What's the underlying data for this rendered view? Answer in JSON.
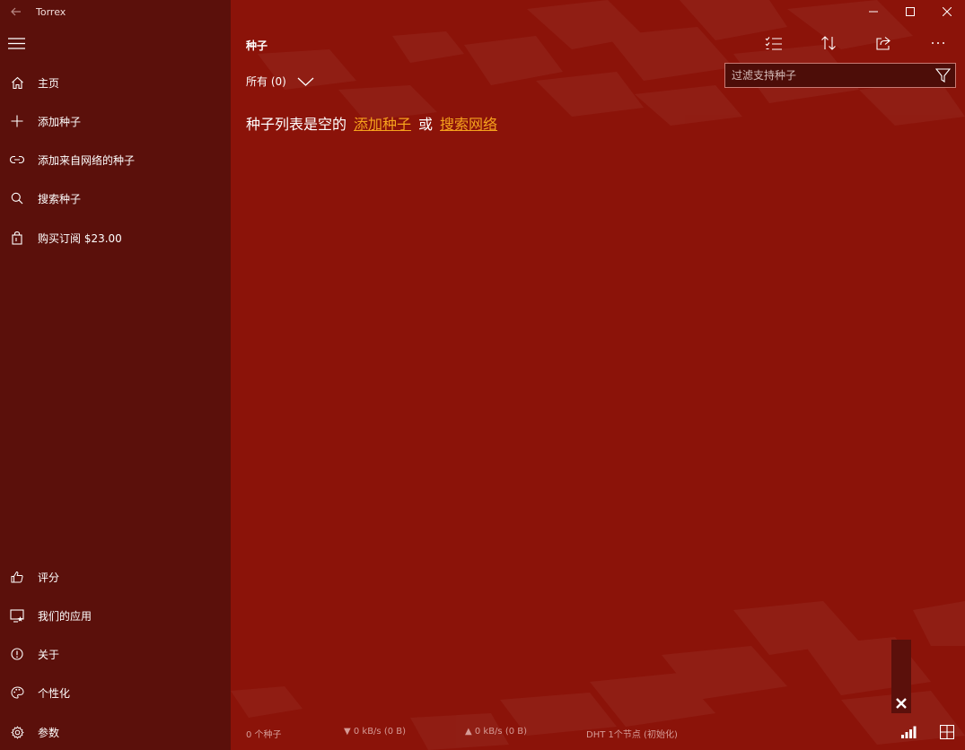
{
  "window": {
    "title": "Torrex",
    "back_icon": "arrow-left-icon"
  },
  "sidebar": {
    "top_items": [
      {
        "icon": "home-icon",
        "label": "主页"
      },
      {
        "icon": "plus-icon",
        "label": "添加种子"
      },
      {
        "icon": "link-icon",
        "label": "添加来自网络的种子"
      },
      {
        "icon": "search-icon",
        "label": "搜索种子"
      },
      {
        "icon": "shopping-bag-icon",
        "label": "购买订阅 $23.00"
      }
    ],
    "bottom_items": [
      {
        "icon": "thumbs-up-icon",
        "label": "评分"
      },
      {
        "icon": "apps-icon",
        "label": "我们的应用"
      },
      {
        "icon": "info-icon",
        "label": "关于"
      },
      {
        "icon": "palette-icon",
        "label": "个性化"
      },
      {
        "icon": "gear-icon",
        "label": "参数"
      }
    ]
  },
  "main": {
    "title": "种子",
    "toolbar": [
      "checklist-icon",
      "sort-icon",
      "share-icon",
      "more-icon"
    ],
    "filter": {
      "placeholder": "过滤支持种子",
      "value": ""
    },
    "dropdown": {
      "label": "所有 (0)"
    },
    "empty": {
      "text": "种子列表是空的",
      "link1": "添加种子",
      "or": "或",
      "link2": "搜索网络"
    }
  },
  "status": {
    "count": "0 个种子",
    "down": "▼ 0 kB/s (0 B)",
    "up": "▲ 0 kB/s (0 B)",
    "dht": "DHT 1个节点 (初始化)"
  },
  "colors": {
    "sidebar": "#5b100b",
    "main": "#8b1309",
    "accent_link": "#f6a21d"
  }
}
